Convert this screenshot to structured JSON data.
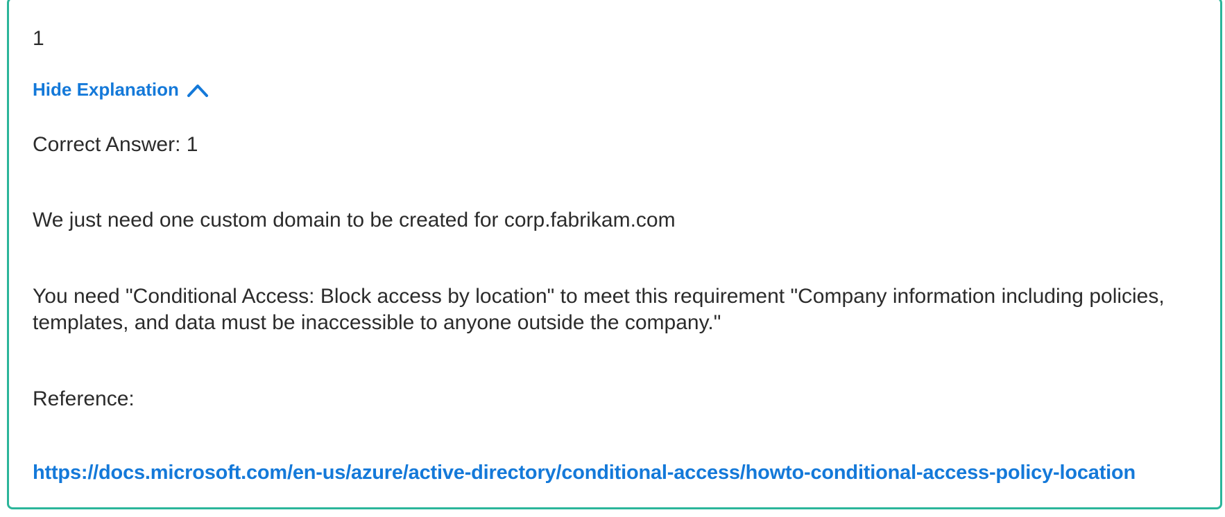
{
  "answer": {
    "selected_value": "1"
  },
  "explanation_toggle": {
    "label": "Hide Explanation",
    "icon": "chevron-up-icon",
    "color": "#1479d9"
  },
  "explanation": {
    "correct_answer": "Correct Answer: 1",
    "paragraph_1": "We just need one custom domain to be created for corp.fabrikam.com",
    "paragraph_2": "You need \"Conditional Access: Block access by location\" to meet this requirement \"Company information including policies, templates, and data must be inaccessible to anyone outside the company.\"",
    "reference_label": "Reference:",
    "reference_link": "https://docs.microsoft.com/en-us/azure/active-directory/conditional-access/howto-conditional-access-policy-location"
  },
  "theme": {
    "card_border": "#2bb59a",
    "link_color": "#1479d9",
    "text_color": "#2b2b2b"
  }
}
